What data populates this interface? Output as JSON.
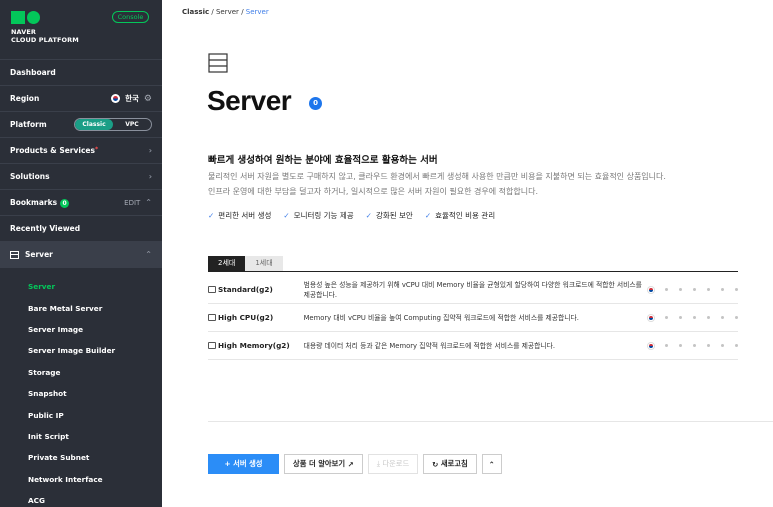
{
  "sidebar": {
    "brand_line1": "NAVER",
    "brand_line2": "CLOUD PLATFORM",
    "console_label": "Console",
    "dashboard": "Dashboard",
    "region_label": "Region",
    "region_value": "한국",
    "platform_label": "Platform",
    "platform_options": [
      "Classic",
      "VPC"
    ],
    "platform_selected": "Classic",
    "products_label": "Products & Services",
    "products_marker": "*",
    "solutions_label": "Solutions",
    "bookmarks_label": "Bookmarks",
    "bookmarks_count": "0",
    "bookmarks_edit": "EDIT",
    "recently_viewed": "Recently Viewed",
    "server_section": "Server",
    "server_items": [
      "Server",
      "Bare Metal Server",
      "Server Image",
      "Server Image Builder",
      "Storage",
      "Snapshot",
      "Public IP",
      "Init Script",
      "Private Subnet",
      "Network Interface",
      "ACG"
    ],
    "active_item": "Server"
  },
  "breadcrumb": {
    "root": "Classic",
    "sep": "/",
    "mid": "Server",
    "current": "Server"
  },
  "page": {
    "title": "Server",
    "count": "0",
    "headline": "빠르게 생성하여 원하는 분야에 효율적으로 활용하는 서버",
    "desc_line1": "물리적인 서버 자원을 별도로 구매하지 않고, 클라우드 환경에서 빠르게 생성해 사용한 만큼만 비용을 지불하면 되는 효율적인 상품입니다.",
    "desc_line2": "인프라 운영에 대한 부담을 덜고자 하거나, 일시적으로 많은 서버 자원이 필요한 경우에 적합합니다.",
    "features": [
      "편리한 서버 생성",
      "모니터링 기능 제공",
      "강화된 보안",
      "효율적인 비용 관리"
    ]
  },
  "tabs": [
    "2세대",
    "1세대"
  ],
  "products": [
    {
      "name": "Standard(g2)",
      "desc": "범용성 높은 성능을 제공하기 위해 vCPU 대비 Memory 비율을 균형있게 할당하여 다양한 워크로드에 적합한 서비스를 제공합니다."
    },
    {
      "name": "High CPU(g2)",
      "desc": "Memory 대비 vCPU 비율을 높여 Computing 집약적 워크로드에 적합한 서비스를 제공합니다."
    },
    {
      "name": "High Memory(g2)",
      "desc": "대용량 데이터 처리 등과 같은 Memory 집약적 워크로드에 적합한 서비스를 제공합니다."
    }
  ],
  "actions": {
    "create": "+ 서버 생성",
    "learn_more": "상품 더 알아보기",
    "download": "다운로드",
    "refresh": "새로고침"
  },
  "colors": {
    "sidebar_bg": "#2b2f38",
    "brand_green": "#03c75a",
    "accent_blue": "#2b8df7"
  }
}
